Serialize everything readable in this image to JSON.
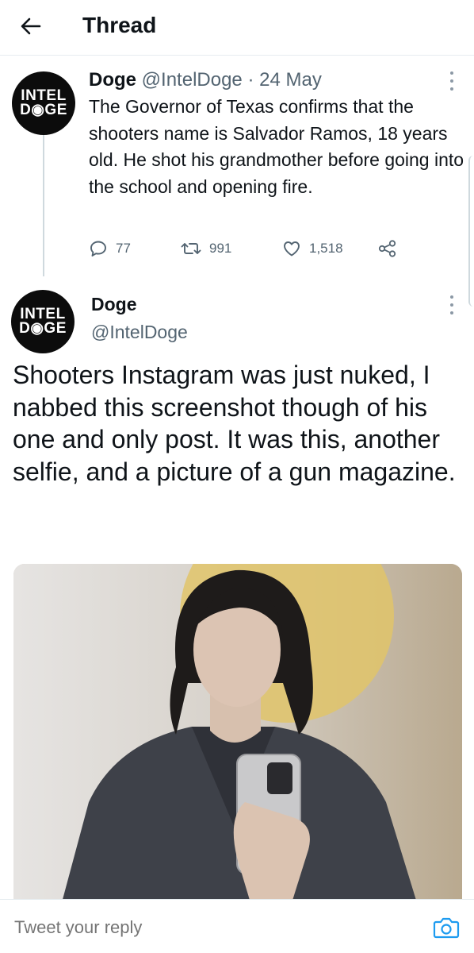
{
  "header": {
    "back_icon": "arrow-left-icon",
    "title": "Thread"
  },
  "tweet1": {
    "avatar": {
      "line1": "INTEL",
      "line2": "D◉GE"
    },
    "name": "Doge",
    "handle": "@IntelDoge",
    "separator": "·",
    "date": "24 May",
    "text": "The Governor of Texas confirms that the shooters name is Salvador Ramos, 18 years old. He shot his grandmother before going into the school and opening fire.",
    "replies": "77",
    "retweets": "991",
    "likes": "1,518",
    "icons": [
      "reply-icon",
      "retweet-icon",
      "like-icon",
      "share-icon",
      "more-icon"
    ]
  },
  "tweet2": {
    "avatar": {
      "line1": "INTEL",
      "line2": "D◉GE"
    },
    "name": "Doge",
    "handle": "@IntelDoge",
    "text": "Shooters Instagram was just nuked, I nabbed this screenshot though of his one and only post. It was this, another selfie, and a picture of a gun magazine."
  },
  "reply_bar": {
    "placeholder": "Tweet your reply",
    "icon": "camera-icon"
  },
  "colors": {
    "text": "#0f1419",
    "muted": "#536471",
    "divider": "#e6ecf0",
    "accent": "#1d9bf0"
  }
}
